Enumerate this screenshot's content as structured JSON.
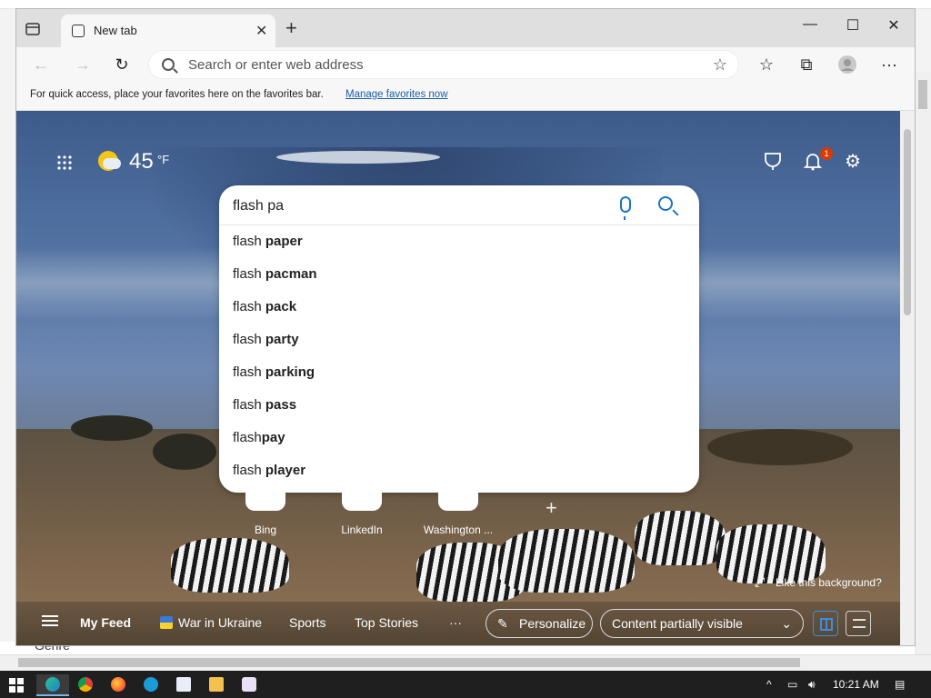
{
  "browser": {
    "tab_title": "New tab",
    "address_placeholder": "Search or enter web address",
    "favorites_bar_text": "For quick access, place your favorites here on the favorites bar.",
    "favorites_bar_link": "Manage favorites now"
  },
  "weather": {
    "temp": "45",
    "unit": "°F"
  },
  "notifications": {
    "count": "1"
  },
  "search": {
    "query": "flash pa",
    "suggestions": [
      {
        "prefix": "flash ",
        "bold": "paper"
      },
      {
        "prefix": "flash ",
        "bold": "pacman"
      },
      {
        "prefix": "flash ",
        "bold": "pack"
      },
      {
        "prefix": "flash ",
        "bold": "party"
      },
      {
        "prefix": "flash ",
        "bold": "parking"
      },
      {
        "prefix": "flash ",
        "bold": "pass"
      },
      {
        "prefix": "flash",
        "bold": "pay"
      },
      {
        "prefix": "flash ",
        "bold": "player"
      }
    ]
  },
  "quick_links": [
    "Bing",
    "LinkedIn",
    "Washington ..."
  ],
  "background": {
    "like_text": "Like this background?"
  },
  "feed": {
    "my_feed": "My Feed",
    "war_in_ukraine": "War in Ukraine",
    "sports": "Sports",
    "top_stories": "Top Stories",
    "more": "···",
    "personalize": "Personalize",
    "content_visibility": "Content partially visible"
  },
  "background_app": {
    "genre_label": "Genre"
  },
  "taskbar": {
    "time": "10:21 AM"
  },
  "colors": {
    "accent": "#1a73c8",
    "link": "#1a5dab",
    "notification": "#d83b01"
  }
}
